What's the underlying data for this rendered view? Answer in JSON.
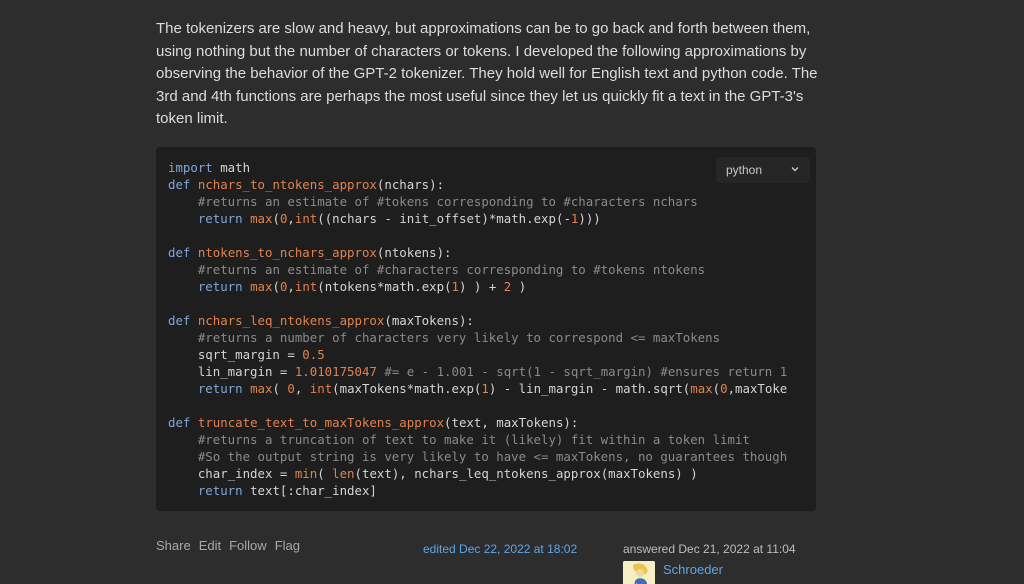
{
  "answer": {
    "paragraph": "The tokenizers are slow and heavy, but approximations can be to go back and forth between them, using nothing but the number of characters or tokens. I developed the following approximations by observing the behavior of the GPT-2 tokenizer. They hold well for English text and python code. The 3rd and 4th functions are perhaps the most useful since they let us quickly fit a text in the GPT-3's token limit."
  },
  "code": {
    "language": "python",
    "lines": [
      "import math",
      "def nchars_to_ntokens_approx(nchars):",
      "    #returns an estimate of #tokens corresponding to #characters nchars",
      "    return max(0,int((nchars - init_offset)*math.exp(-1)))",
      "",
      "def ntokens_to_nchars_approx(ntokens):",
      "    #returns an estimate of #characters corresponding to #tokens ntokens",
      "    return max(0,int(ntokens*math.exp(1) ) + 2 )",
      "",
      "def nchars_leq_ntokens_approx(maxTokens):",
      "    #returns a number of characters very likely to correspond <= maxTokens",
      "    sqrt_margin = 0.5",
      "    lin_margin = 1.010175047 #= e - 1.001 - sqrt(1 - sqrt_margin) #ensures return 1",
      "    return max( 0, int(maxTokens*math.exp(1) - lin_margin - math.sqrt(max(0,maxToke",
      "",
      "def truncate_text_to_maxTokens_approx(text, maxTokens):",
      "    #returns a truncation of text to make it (likely) fit within a token limit",
      "    #So the output string is very likely to have <= maxTokens, no guarantees though",
      "    char_index = min( len(text), nchars_leq_ntokens_approx(maxTokens) )",
      "    return text[:char_index]"
    ]
  },
  "post_menu": {
    "share": "Share",
    "edit": "Edit",
    "follow": "Follow",
    "flag": "Flag"
  },
  "edited": "edited Dec 22, 2022 at 18:02",
  "answered": "answered Dec 21, 2022 at 11:04",
  "user": {
    "name": "Schroeder",
    "avatar_icon": "user-avatar-icon"
  },
  "colors": {
    "background": "#2d2d2d",
    "code_background": "#1e1e1e",
    "keyword": "#7fa6d6",
    "function": "#e0824f",
    "comment": "#8a8a8a",
    "link": "#5ea6e8"
  }
}
